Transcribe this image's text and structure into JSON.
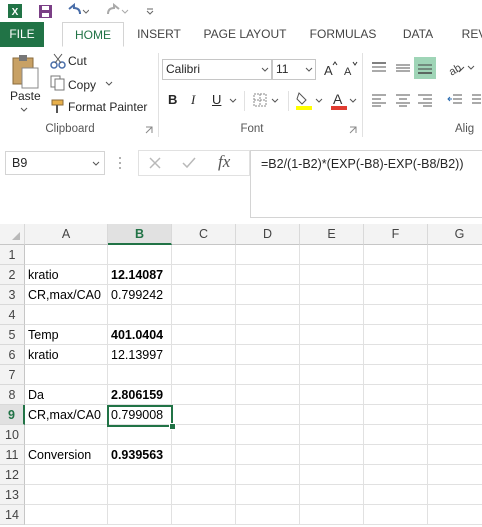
{
  "quick_access": {
    "icons": [
      "excel-app-icon",
      "save-icon",
      "undo-icon",
      "redo-icon",
      "customize-icon"
    ]
  },
  "tabs": [
    {
      "label": "FILE"
    },
    {
      "label": "HOME"
    },
    {
      "label": "INSERT"
    },
    {
      "label": "PAGE LAYOUT"
    },
    {
      "label": "FORMULAS"
    },
    {
      "label": "DATA"
    },
    {
      "label": "REV"
    }
  ],
  "ribbon": {
    "clipboard": {
      "paste": "Paste",
      "cut": "Cut",
      "copy": "Copy",
      "format_painter": "Format Painter",
      "label": "Clipboard"
    },
    "font": {
      "name": "Calibri",
      "size": "11",
      "bold": "B",
      "italic": "I",
      "underline": "U",
      "label": "Font",
      "font_color": "A"
    },
    "alignment": {
      "label": "Alig"
    }
  },
  "formula_bar": {
    "name_box": "B9",
    "fx": "fx",
    "formula": "=B2/(1-B2)*(EXP(-B8)-EXP(-B8/B2))"
  },
  "columns": [
    "A",
    "B",
    "C",
    "D",
    "E",
    "F",
    "G"
  ],
  "rows": [
    {
      "n": "1",
      "a": "",
      "b": "",
      "bold": false
    },
    {
      "n": "2",
      "a": "kratio",
      "b": "12.14087",
      "bold": true
    },
    {
      "n": "3",
      "a": "CR,max/CA0",
      "b": "0.799242",
      "bold": false
    },
    {
      "n": "4",
      "a": "",
      "b": "",
      "bold": false
    },
    {
      "n": "5",
      "a": "Temp",
      "b": "401.0404",
      "bold": true
    },
    {
      "n": "6",
      "a": "kratio",
      "b": "12.13997",
      "bold": false
    },
    {
      "n": "7",
      "a": "",
      "b": "",
      "bold": false
    },
    {
      "n": "8",
      "a": "Da",
      "b": "2.806159",
      "bold": true
    },
    {
      "n": "9",
      "a": "CR,max/CA0",
      "b": "0.799008",
      "bold": false
    },
    {
      "n": "10",
      "a": "",
      "b": "",
      "bold": false
    },
    {
      "n": "11",
      "a": "Conversion",
      "b": "0.939563",
      "bold": true
    },
    {
      "n": "12",
      "a": "",
      "b": "",
      "bold": false
    },
    {
      "n": "13",
      "a": "",
      "b": "",
      "bold": false
    },
    {
      "n": "14",
      "a": "",
      "b": "",
      "bold": false
    }
  ],
  "selected_cell": "B9",
  "colors": {
    "accent": "#217346",
    "header_bg": "#f3f3f3",
    "font_color_bar": "#e03c31",
    "highlight_bar": "#ffff00"
  }
}
